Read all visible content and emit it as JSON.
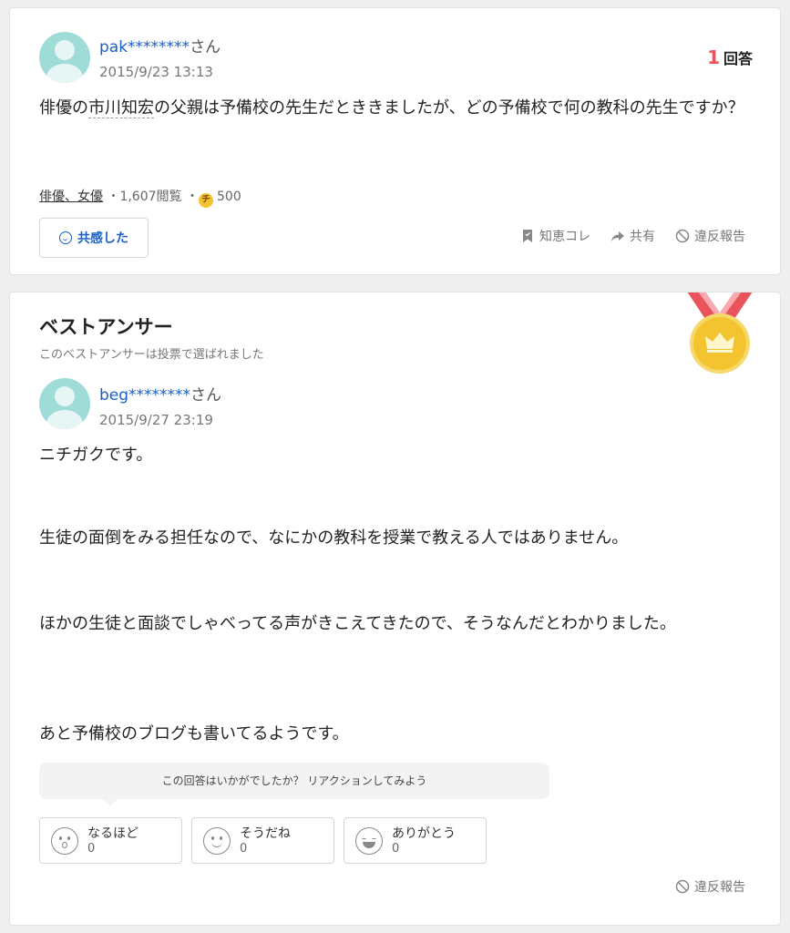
{
  "question": {
    "user_name": "pak********",
    "user_suffix": "さん",
    "date": "2015/9/23 13:13",
    "answers_num": "1",
    "answers_label": "回答",
    "text_before": "俳優の",
    "text_term": "市川知宏",
    "text_after": "の父親は予備校の先生だとききましたが、どの予備校で何の教科の先生ですか？",
    "category": "俳優、女優",
    "sep1": "・",
    "views": "1,607閲覧",
    "sep2": "・",
    "coin_glyph": "チ",
    "coins": "500",
    "empathy_label": "共感した",
    "actions": {
      "bookmark_label": "知恵コレ",
      "share_label": "共有",
      "report_label": "違反報告"
    }
  },
  "best_answer": {
    "title": "ベストアンサー",
    "subtitle": "このベストアンサーは投票で選ばれました",
    "user_name": "beg********",
    "user_suffix": "さん",
    "date": "2015/9/27 23:19",
    "paragraphs": [
      "ニチガクです。",
      "生徒の面倒をみる担任なので、なにかの教科を授業で教える人ではありません。",
      "ほかの生徒と面談でしゃべってる声がきこえてきたので、そうなんだとわかりました。",
      "あと予備校のブログも書いてるようです。"
    ],
    "reaction_prompt": "この回答はいかがでしたか？ リアクションしてみよう",
    "reactions": [
      {
        "label": "なるほど",
        "count": "0",
        "icon": "surprised-face-icon"
      },
      {
        "label": "そうだね",
        "count": "0",
        "icon": "smile-face-icon"
      },
      {
        "label": "ありがとう",
        "count": "0",
        "icon": "grin-face-icon"
      }
    ],
    "report_label": "違反報告"
  },
  "colors": {
    "link": "#1a5fc8",
    "answer_count": "#e9545c",
    "avatar": "#9fdcd8",
    "medal_gold": "#f4c430",
    "ribbon": "#e9545c"
  }
}
